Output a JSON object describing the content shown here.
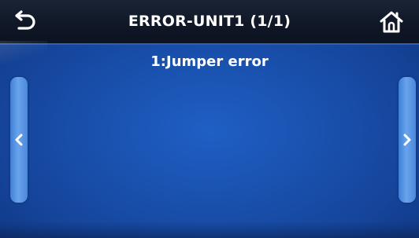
{
  "header": {
    "title": "ERROR-UNIT1 (1/1)",
    "back_icon": "back-arrow-icon",
    "home_icon": "home-icon"
  },
  "content": {
    "errors": [
      {
        "text": "1:Jumper error"
      }
    ]
  },
  "nav": {
    "prev_icon": "chevron-left-icon",
    "next_icon": "chevron-right-icon"
  },
  "colors": {
    "header_bg": "#101827",
    "screen_bg": "#1a52b0",
    "side_button": "#5a97e4",
    "text": "#ffffff"
  }
}
